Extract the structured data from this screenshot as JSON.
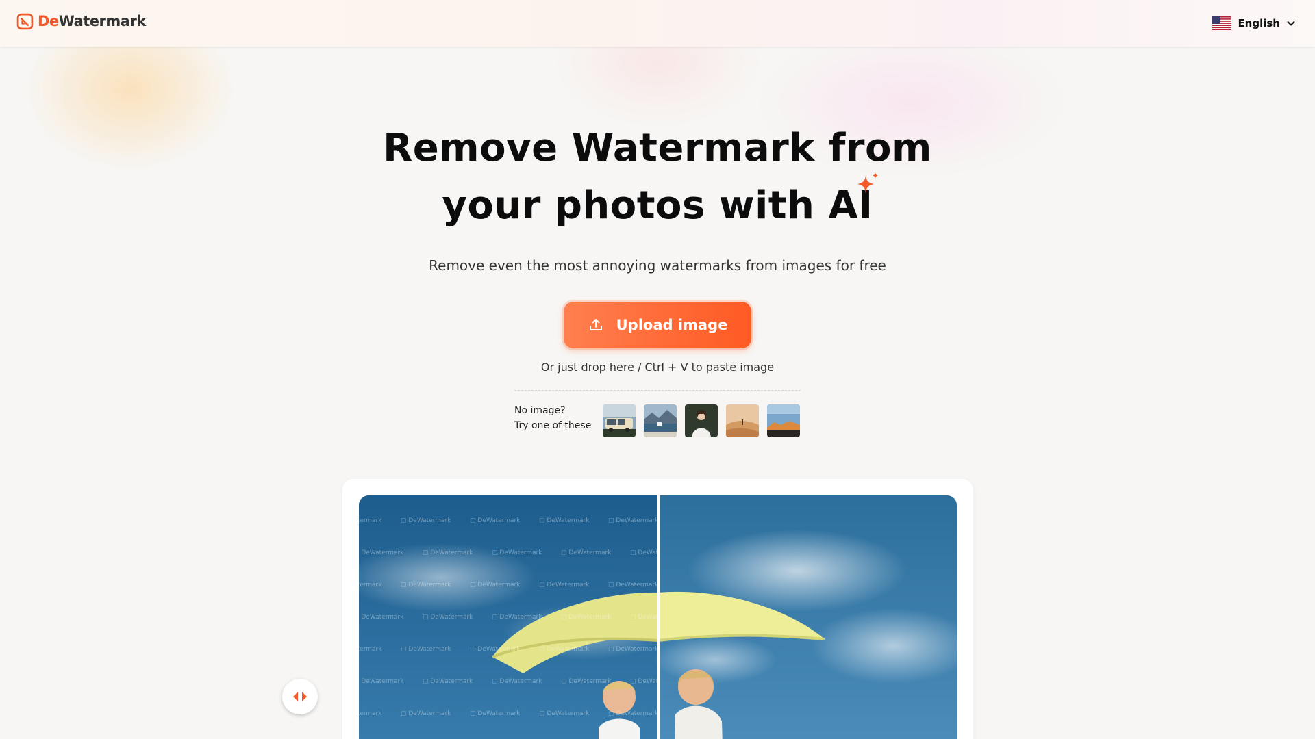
{
  "header": {
    "logo_prefix": "De",
    "logo_suffix": "Watermark",
    "language_label": "English"
  },
  "hero": {
    "title_line1": "Remove Watermark from",
    "title_line2": "your photos with AI",
    "subtitle": "Remove even the most annoying watermarks from images for free",
    "upload_label": "Upload image",
    "drop_hint": "Or just drop here / Ctrl + V to paste image"
  },
  "samples": {
    "label_line1": "No image?",
    "label_line2": "Try one of these",
    "items": [
      {
        "icon": "van-thumbnail"
      },
      {
        "icon": "lake-thumbnail"
      },
      {
        "icon": "portrait-thumbnail"
      },
      {
        "icon": "desert-thumbnail"
      },
      {
        "icon": "mountain-sunset-thumbnail"
      }
    ]
  },
  "comparison": {
    "watermark_text": "DeWatermark"
  },
  "colors": {
    "accent": "#ff5a24",
    "accent_light": "#ff7f4f",
    "title": "#0c0c0c"
  }
}
